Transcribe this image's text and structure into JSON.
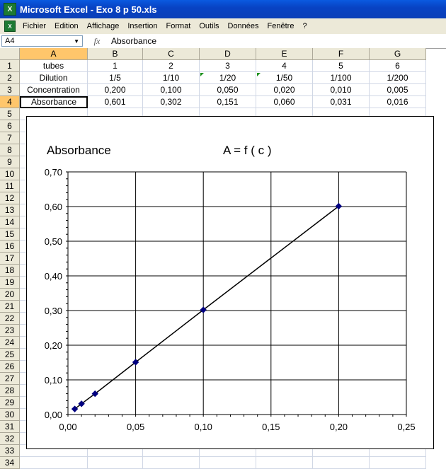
{
  "window": {
    "title": "Microsoft Excel - Exo 8 p 50.xls"
  },
  "menu": [
    "Fichier",
    "Edition",
    "Affichage",
    "Insertion",
    "Format",
    "Outils",
    "Données",
    "Fenêtre",
    "?"
  ],
  "formula_bar": {
    "name_box": "A4",
    "fx": "fx",
    "value": "Absorbance"
  },
  "columns": [
    "A",
    "B",
    "C",
    "D",
    "E",
    "F",
    "G"
  ],
  "rows": [
    "1",
    "2",
    "3",
    "4",
    "5",
    "6",
    "7",
    "8",
    "9",
    "10",
    "11",
    "12",
    "13",
    "14",
    "15",
    "16",
    "17",
    "18",
    "19",
    "20",
    "21",
    "22",
    "23",
    "24",
    "25",
    "26",
    "27",
    "28",
    "29",
    "30",
    "31",
    "32",
    "33",
    "34"
  ],
  "sheet": {
    "row1": [
      "tubes",
      "1",
      "2",
      "3",
      "4",
      "5",
      "6"
    ],
    "row2": [
      "Dilution",
      "1/5",
      "1/10",
      "1/20",
      "1/50",
      "1/100",
      "1/200"
    ],
    "row3": [
      "Concentration",
      "0,200",
      "0,100",
      "0,050",
      "0,020",
      "0,010",
      "0,005"
    ],
    "row4": [
      "Absorbance",
      "0,601",
      "0,302",
      "0,151",
      "0,060",
      "0,031",
      "0,016"
    ]
  },
  "chart": {
    "title_left": "Absorbance",
    "title_right": "A = f ( c )",
    "x_ticks": [
      "0,00",
      "0,05",
      "0,10",
      "0,15",
      "0,20",
      "0,25"
    ],
    "y_ticks": [
      "0,00",
      "0,10",
      "0,20",
      "0,30",
      "0,40",
      "0,50",
      "0,60",
      "0,70"
    ],
    "line_color": "#000000",
    "marker_color": "#000080"
  },
  "chart_data": {
    "type": "scatter",
    "title": "A = f ( c )",
    "ylabel": "Absorbance",
    "xlabel": "",
    "x": [
      0.2,
      0.1,
      0.05,
      0.02,
      0.01,
      0.005
    ],
    "y": [
      0.601,
      0.302,
      0.151,
      0.06,
      0.031,
      0.016
    ],
    "xlim": [
      0,
      0.25
    ],
    "ylim": [
      0,
      0.7
    ],
    "grid": true
  }
}
